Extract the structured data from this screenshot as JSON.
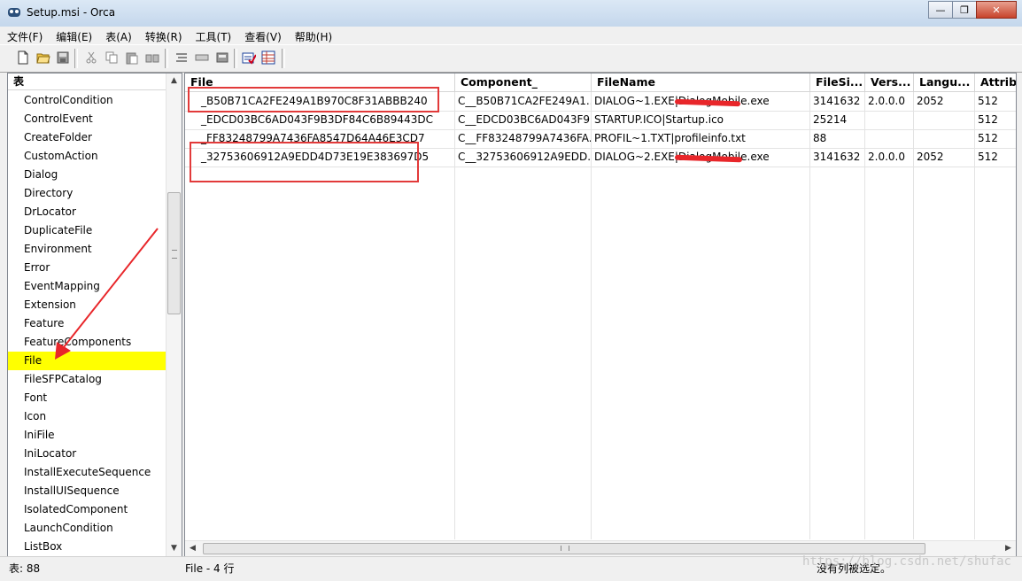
{
  "window": {
    "title": "Setup.msi - Orca"
  },
  "menu": [
    "文件(F)",
    "编辑(E)",
    "表(A)",
    "转换(R)",
    "工具(T)",
    "查看(V)",
    "帮助(H)"
  ],
  "toolbar_icons": [
    "new-icon",
    "open-icon",
    "save-icon",
    "cut-icon",
    "copy-icon",
    "paste-icon",
    "find-icon",
    "tool1-icon",
    "tool2-icon",
    "tool3-icon",
    "validate-icon",
    "table-icon"
  ],
  "left": {
    "header": "表",
    "tables": [
      "ControlCondition",
      "ControlEvent",
      "CreateFolder",
      "CustomAction",
      "Dialog",
      "Directory",
      "DrLocator",
      "DuplicateFile",
      "Environment",
      "Error",
      "EventMapping",
      "Extension",
      "Feature",
      "FeatureComponents",
      "File",
      "FileSFPCatalog",
      "Font",
      "Icon",
      "IniFile",
      "IniLocator",
      "InstallExecuteSequence",
      "InstallUISequence",
      "IsolatedComponent",
      "LaunchCondition",
      "ListBox"
    ],
    "selected": "File"
  },
  "grid": {
    "columns": [
      "File",
      "Component_",
      "FileName",
      "FileSi...",
      "Vers...",
      "Langu...",
      "Attribu"
    ],
    "rows": [
      [
        "_B50B71CA2FE249A1B970C8F31ABBB240",
        "C__B50B71CA2FE249A1...",
        "DIALOG~1.EXE|DialogMobile.exe",
        "3141632",
        "2.0.0.0",
        "2052",
        "512"
      ],
      [
        "_EDCD03BC6AD043F9B3DF84C6B89443DC",
        "C__EDCD03BC6AD043F9...",
        "STARTUP.ICO|Startup.ico",
        "25214",
        "",
        "",
        "512"
      ],
      [
        "_FF83248799A7436FA8547D64A46E3CD7",
        "C__FF83248799A7436FA...",
        "PROFIL~1.TXT|profileinfo.txt",
        "88",
        "",
        "",
        "512"
      ],
      [
        "_32753606912A9EDD4D73E19E383697D5",
        "C__32753606912A9EDD...",
        "DIALOG~2.EXE|DialogMobile.exe",
        "3141632",
        "2.0.0.0",
        "2052",
        "512"
      ]
    ]
  },
  "status": {
    "left": "表: 88",
    "middle": "File - 4 行",
    "right": "没有列被选定。"
  },
  "watermark": "https://blog.csdn.net/shufac"
}
